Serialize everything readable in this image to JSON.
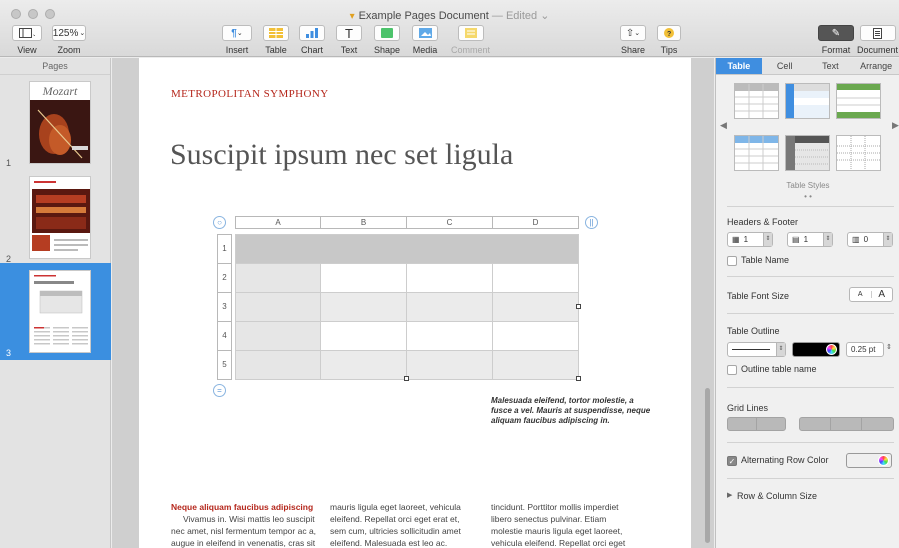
{
  "window": {
    "title": "Example Pages Document",
    "status": "— Edited",
    "title_chevron": "⌄"
  },
  "toolbar": {
    "view_label": "View",
    "zoom_value": "125%",
    "zoom_label": "Zoom",
    "insert_label": "Insert",
    "table_label": "Table",
    "chart_label": "Chart",
    "text_label": "Text",
    "shape_label": "Shape",
    "media_label": "Media",
    "comment_label": "Comment",
    "share_label": "Share",
    "tips_label": "Tips",
    "format_label": "Format",
    "document_label": "Document"
  },
  "sidebar": {
    "title": "Pages",
    "pages": [
      {
        "number": "1",
        "thumb_text": "Mozart"
      },
      {
        "number": "2",
        "thumb_text": ""
      },
      {
        "number": "3",
        "thumb_text": ""
      }
    ],
    "selected_page": 3
  },
  "document": {
    "orchestra": "METROPOLITAN SYMPHONY",
    "headline": "Suscipit ipsum nec set ligula",
    "table": {
      "columns": [
        "A",
        "B",
        "C",
        "D"
      ],
      "rows": [
        "1",
        "2",
        "3",
        "4",
        "5"
      ]
    },
    "caption": "Malesuada eleifend, tortor molestie, a fusce a vel. Mauris at suspendisse, neque aliquam faucibus adipiscing in.",
    "col1_heading": "Neque aliquam faucibus adipiscing",
    "col1_lines": [
      "Vivamus in. Wisi mattis leo suscipit",
      "nec amet, nisl fermentum tempor ac a,",
      "augue in eleifend in venenatis, cras sit"
    ],
    "col2_lines": [
      "mauris ligula eget laoreet, vehicula",
      "eleifend. Repellat orci eget erat et,",
      "sem cum, ultricies sollicitudin amet",
      "eleifend. Malesuada est leo ac."
    ],
    "col3_lines": [
      "tincidunt. Porttitor mollis imperdiet",
      "libero senectus pulvinar. Etiam",
      "molestie mauris ligula eget laoreet,",
      "vehicula eleifend. Repellat orci eget"
    ]
  },
  "inspector": {
    "tabs": [
      "Table",
      "Cell",
      "Text",
      "Arrange"
    ],
    "active_tab": "Table",
    "table_styles_label": "Table Styles",
    "headers_footer_label": "Headers & Footer",
    "header_rows": "1",
    "header_columns": "1",
    "footer_rows": "0",
    "table_name_label": "Table Name",
    "table_name_checked": false,
    "table_font_size_label": "Table Font Size",
    "font_smaller": "A",
    "font_larger": "A",
    "table_outline_label": "Table Outline",
    "outline_width": "0.25 pt",
    "outline_color": "#000000",
    "outline_table_name_label": "Outline table name",
    "grid_lines_label": "Grid Lines",
    "alternating_row_color_label": "Alternating Row Color",
    "alternating_row_checked": true,
    "row_column_size_label": "Row & Column Size"
  },
  "colors": {
    "accent": "#3f8ee0",
    "brand_red": "#b5271c",
    "table_header": "#c8c8c8",
    "table_alt_row": "#ebebeb"
  }
}
